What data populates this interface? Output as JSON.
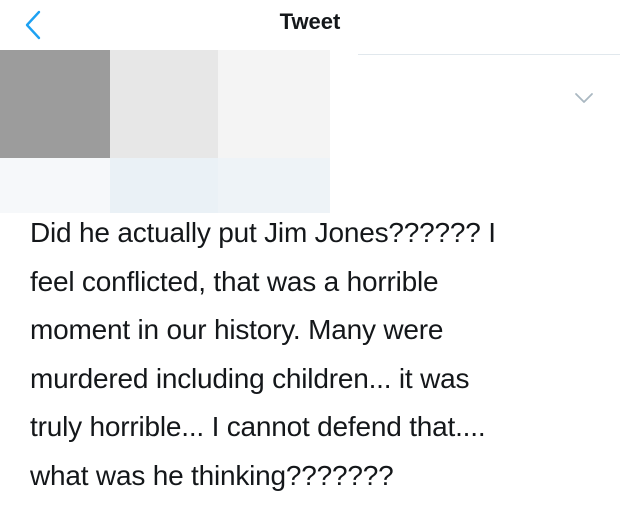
{
  "header": {
    "title": "Tweet",
    "back_icon": "chevron-left-icon",
    "accent_color": "#1da1f2"
  },
  "author": {
    "avatar": "blurred-placeholder",
    "name_redacted": true
  },
  "menu": {
    "icon": "chevron-down-icon"
  },
  "tweet": {
    "line_1": "Did he actually put Jim Jones?????? I",
    "line_2": "feel conflicted, that was a horrible",
    "line_3": "moment in our history. Many were",
    "line_4": "murdered including children... it was",
    "line_5": "truly horrible... I cannot defend that....",
    "line_6": "what was he thinking???????"
  }
}
